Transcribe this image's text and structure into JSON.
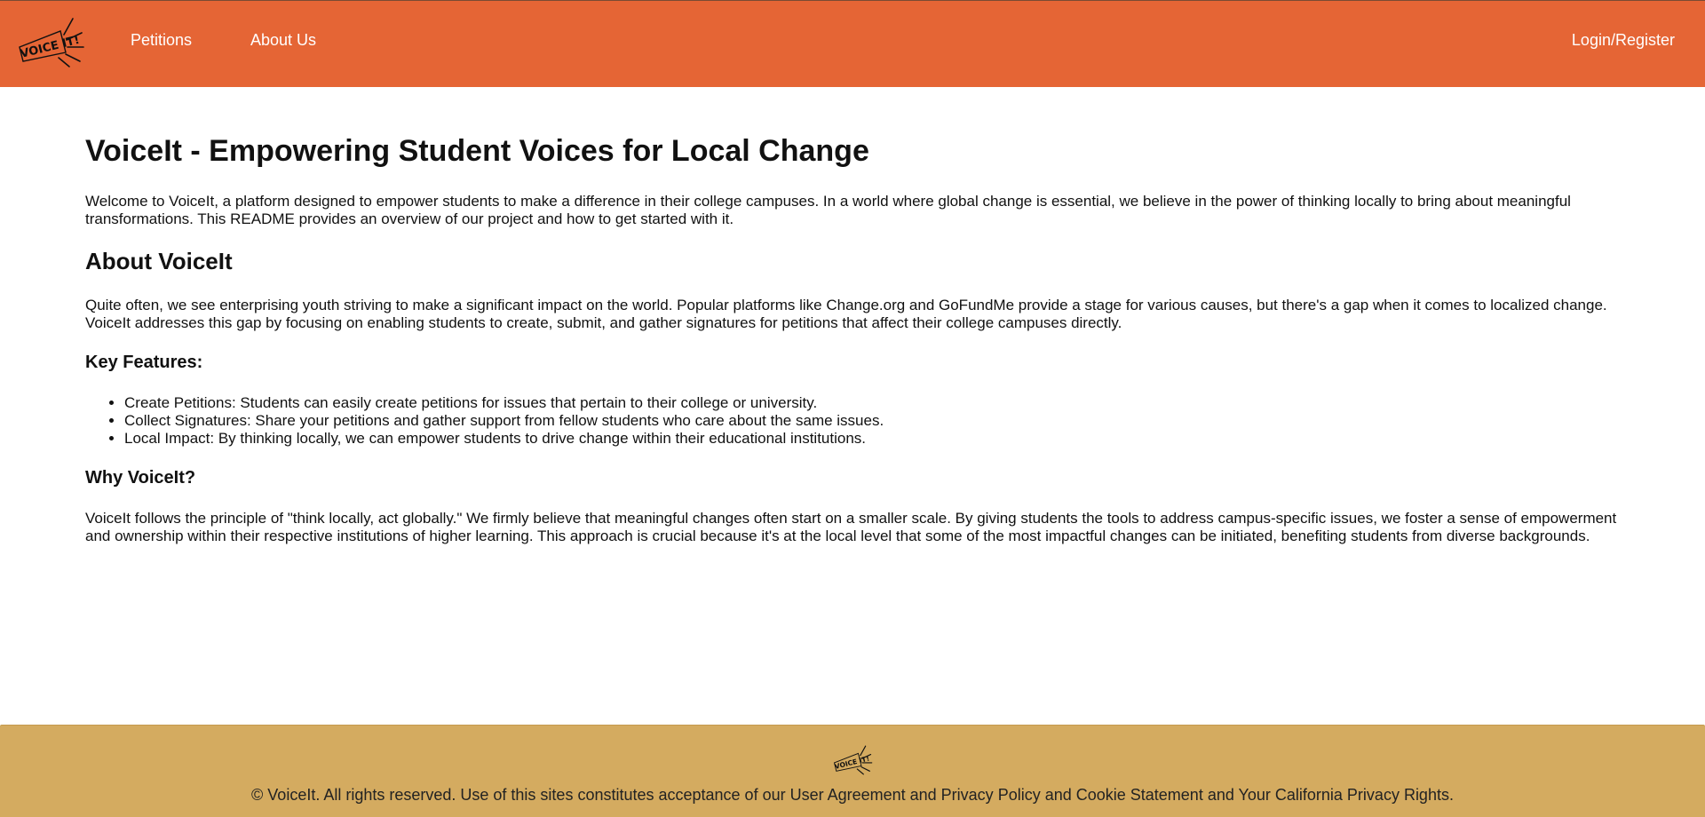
{
  "brand": {
    "logo_text": "VOICE IT!",
    "header_color": "#e56535",
    "footer_color": "#d4ab60"
  },
  "nav": {
    "petitions": "Petitions",
    "about": "About Us",
    "login": "Login/Register"
  },
  "main": {
    "title": "VoiceIt - Empowering Student Voices for Local Change",
    "intro": "Welcome to VoiceIt, a platform designed to empower students to make a difference in their college campuses. In a world where global change is essential, we believe in the power of thinking locally to bring about meaningful transformations. This README provides an overview of our project and how to get started with it.",
    "about_heading": "About VoiceIt",
    "about_text": "Quite often, we see enterprising youth striving to make a significant impact on the world. Popular platforms like Change.org and GoFundMe provide a stage for various causes, but there's a gap when it comes to localized change. VoiceIt addresses this gap by focusing on enabling students to create, submit, and gather signatures for petitions that affect their college campuses directly.",
    "features_heading": "Key Features:",
    "features": [
      "Create Petitions: Students can easily create petitions for issues that pertain to their college or university.",
      "Collect Signatures: Share your petitions and gather support from fellow students who care about the same issues.",
      "Local Impact: By thinking locally, we can empower students to drive change within their educational institutions."
    ],
    "why_heading": "Why VoiceIt?",
    "why_text": "VoiceIt follows the principle of \"think locally, act globally.\" We firmly believe that meaningful changes often start on a smaller scale. By giving students the tools to address campus-specific issues, we foster a sense of empowerment and ownership within their respective institutions of higher learning. This approach is crucial because it's at the local level that some of the most impactful changes can be initiated, benefiting students from diverse backgrounds."
  },
  "footer": {
    "text": "© VoiceIt. All rights reserved. Use of this sites constitutes acceptance of our User Agreement and Privacy Policy and Cookie Statement and Your California Privacy Rights."
  }
}
